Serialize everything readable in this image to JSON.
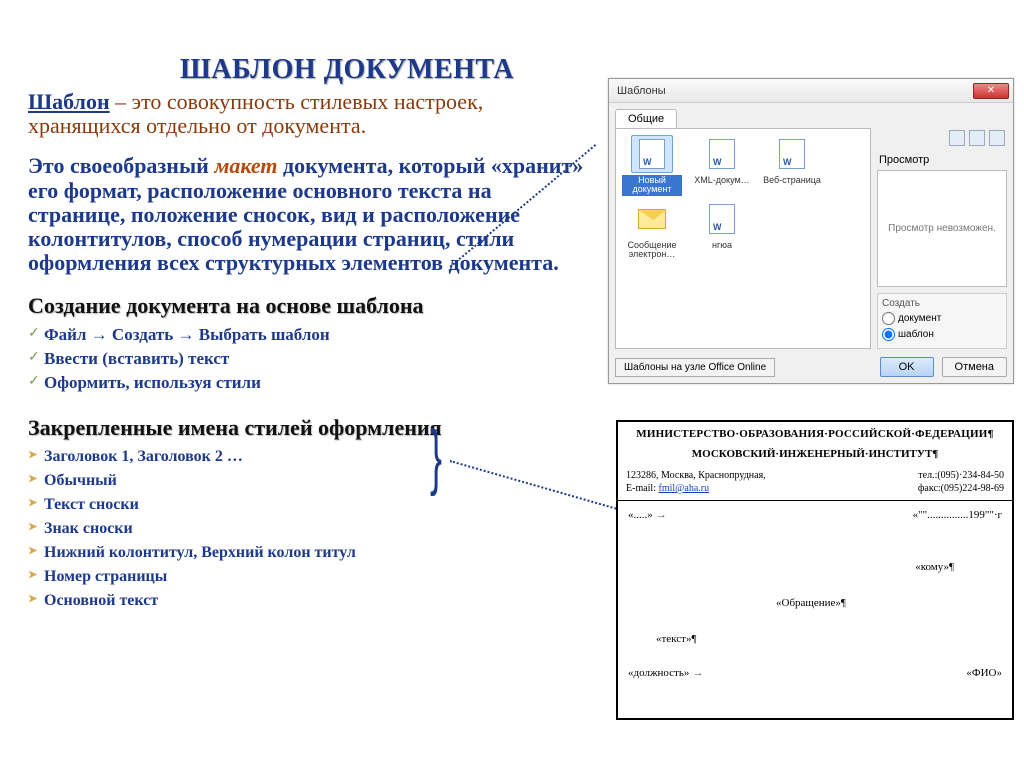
{
  "title": "ШАБЛОН ДОКУМЕНТА",
  "para1": {
    "term": "Шаблон",
    "rest1": " – это совокупность стилевых настроек, хранящихся отдельно от документа."
  },
  "para2": {
    "pre": "Это своеобразный ",
    "maket": "макет",
    "post": " документа, который «хранит» его формат, расположение основного текста на странице, положение сносок, вид и расположение колонтитулов, способ нумерации страниц, стили оформления всех структурных элементов документа."
  },
  "sub1": "Создание документа на основе шаблона",
  "check": [
    "Файл → Создать → Выбрать шаблон",
    "Ввести (вставить) текст",
    "Оформить, используя стили"
  ],
  "sub2": "Закрепленные имена стилей оформления",
  "styles": [
    "Заголовок 1, Заголовок 2 …",
    "Обычный",
    "Текст сноски",
    "Знак сноски",
    "Нижний колонтитул, Верхний колон титул",
    "Номер страницы",
    "Основной текст"
  ],
  "dialog": {
    "title": "Шаблоны",
    "tab": "Общие",
    "items": [
      "Новый документ",
      "XML-докум…",
      "Веб-страница",
      "Сообщение электрон…",
      "нгюа"
    ],
    "right_label": "Просмотр",
    "preview_text": "Просмотр невозможен.",
    "create_label": "Создать",
    "opt_doc": "документ",
    "opt_tpl": "шаблон",
    "online_btn": "Шаблоны на узле Office Online",
    "ok": "OK",
    "cancel": "Отмена"
  },
  "doc": {
    "line1": "МИНИСТЕРСТВО·ОБРАЗОВАНИЯ·РОССИЙСКОЙ·ФЕДЕРАЦИИ¶",
    "line2": "МОСКОВСКИЙ·ИНЖЕНЕРНЫЙ·ИНСТИТУТ¶",
    "addr_left": "123286, Москва, Краснопрудная,",
    "addr_right": "тел.:(095)·234-84-50",
    "email_pre": "E-mail: ",
    "email": "fmil@aha.ru",
    "fax": "факс:(095)224-98-69",
    "ph_num": "«.....»",
    "ph_date": "«\"\"...............199\"\"·г",
    "ph_komu": "«кому»¶",
    "ph_obr": "«Обращение»¶",
    "ph_text": "«текст»¶",
    "ph_dol": "«должность»",
    "ph_fio": "«ФИО»"
  }
}
